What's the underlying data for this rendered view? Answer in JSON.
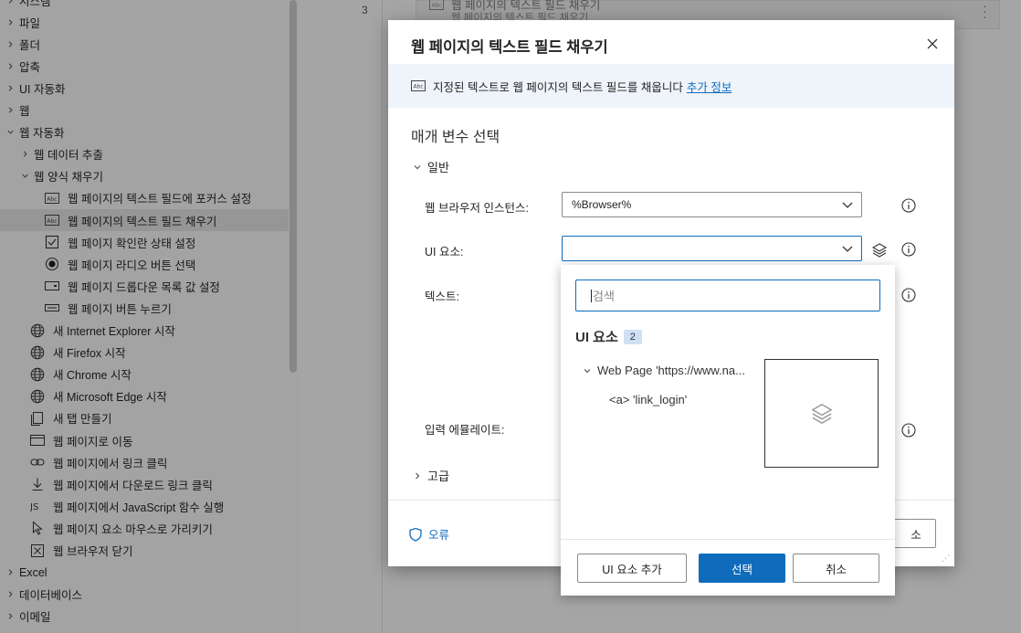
{
  "left_panel": {
    "items": [
      {
        "label": "시스템",
        "level": 0,
        "icon": "",
        "expanded": false
      },
      {
        "label": "파일",
        "level": 0,
        "icon": "",
        "expanded": false
      },
      {
        "label": "폴더",
        "level": 0,
        "icon": "",
        "expanded": false
      },
      {
        "label": "압축",
        "level": 0,
        "icon": "",
        "expanded": false
      },
      {
        "label": "UI 자동화",
        "level": 0,
        "icon": "",
        "expanded": false
      },
      {
        "label": "웹",
        "level": 0,
        "icon": "",
        "expanded": false
      },
      {
        "label": "웹 자동화",
        "level": 0,
        "icon": "",
        "expanded": true
      },
      {
        "label": "웹 데이터 추출",
        "level": 1,
        "icon": "",
        "expanded": false
      },
      {
        "label": "웹 양식 채우기",
        "level": 1,
        "icon": "",
        "expanded": true
      },
      {
        "label": "웹 페이지의 텍스트 필드에 포커스 설정",
        "level": 2,
        "icon": "textbox-icon"
      },
      {
        "label": "웹 페이지의 텍스트 필드 채우기",
        "level": 2,
        "icon": "textbox-icon",
        "selected": true
      },
      {
        "label": "웹 페이지 확인란 상태 설정",
        "level": 2,
        "icon": "checkbox-icon"
      },
      {
        "label": "웹 페이지 라디오 버튼 선택",
        "level": 2,
        "icon": "radio-icon"
      },
      {
        "label": "웹 페이지 드롭다운 목록 값 설정",
        "level": 2,
        "icon": "dropdown-icon"
      },
      {
        "label": "웹 페이지 버튼 누르기",
        "level": 2,
        "icon": "button-icon"
      },
      {
        "label": "새 Internet Explorer 시작",
        "level": 1,
        "icon": "globe-icon"
      },
      {
        "label": "새 Firefox 시작",
        "level": 1,
        "icon": "globe-icon"
      },
      {
        "label": "새 Chrome 시작",
        "level": 1,
        "icon": "globe-icon"
      },
      {
        "label": "새 Microsoft Edge 시작",
        "level": 1,
        "icon": "globe-icon"
      },
      {
        "label": "새 탭 만들기",
        "level": 1,
        "icon": "new-tab-icon"
      },
      {
        "label": "웹 페이지로 이동",
        "level": 1,
        "icon": "window-icon"
      },
      {
        "label": "웹 페이지에서 링크 클릭",
        "level": 1,
        "icon": "link-icon"
      },
      {
        "label": "웹 페이지에서 다운로드 링크 클릭",
        "level": 1,
        "icon": "download-icon"
      },
      {
        "label": "웹 페이지에서 JavaScript 함수 실행",
        "level": 1,
        "icon": "js-icon"
      },
      {
        "label": "웹 페이지 요소 마우스로 가리키기",
        "level": 1,
        "icon": "cursor-icon"
      },
      {
        "label": "웹 브라우저 닫기",
        "level": 1,
        "icon": "close-box-icon"
      },
      {
        "label": "Excel",
        "level": 0,
        "icon": "",
        "expanded": false
      },
      {
        "label": "데이터베이스",
        "level": 0,
        "icon": "",
        "expanded": false
      },
      {
        "label": "이메일",
        "level": 0,
        "icon": "",
        "expanded": false
      }
    ]
  },
  "background": {
    "line_number": "3",
    "card_title": "웹 페이지의 텍스트 필드 채우기",
    "card_subtitle": "웹 페이지의 텍스트 필드 채우기"
  },
  "dialog": {
    "title": "웹 페이지의 텍스트 필드 채우기",
    "info_text": "지정된 텍스트로 웹 페이지의 텍스트 필드를 채웁니다",
    "info_link": "추가 정보",
    "section_title": "매개 변수 선택",
    "general_label": "일반",
    "fields": {
      "browser_label": "웹 브라우저 인스턴스:",
      "browser_value": "%Browser%",
      "ui_element_label": "UI 요소:",
      "ui_element_value": "",
      "text_label": "텍스트:",
      "emulate_label": "입력 에뮬레이트:"
    },
    "advanced_label": "고급",
    "error_label": "오류",
    "hidden_button_label": "소"
  },
  "popup": {
    "search_placeholder": "검색",
    "heading": "UI 요소",
    "count": "2",
    "tree_node": "Web Page 'https://www.na...",
    "tree_child": "<a> 'link_login'",
    "buttons": {
      "add": "UI 요소 추가",
      "select": "선택",
      "cancel": "취소"
    }
  },
  "colors": {
    "accent": "#0f6cbd",
    "info_bar": "#eff4fa",
    "badge": "#cfe0f5"
  }
}
